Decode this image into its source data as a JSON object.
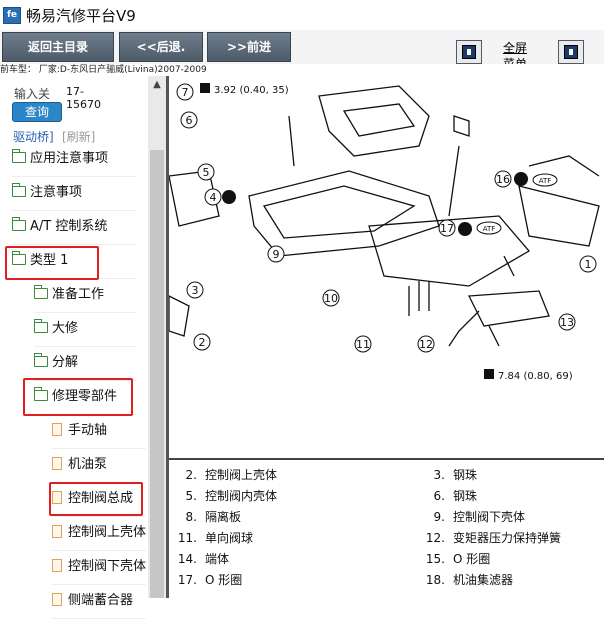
{
  "window": {
    "title": "畅易汽修平台V9",
    "icon": "app-logo-icon"
  },
  "toolbar": {
    "home_label": "返回主目录",
    "back_label": "<<后退.",
    "forward_label": ">>前进",
    "fullscreen_label": "全屏",
    "menu_label": "菜单"
  },
  "breadcrumb": "前车型： 厂家:D-东风日产骊威(Livina)2007-2009",
  "search": {
    "label": "输入关",
    "value_line1": "17-",
    "value_line2": "15670",
    "button_label": "查询"
  },
  "sidebar": {
    "section_title": "驱动桥]",
    "refresh_label": "[刷新]",
    "items": [
      {
        "label": "应用注意事项",
        "icon": "folder-icon"
      },
      {
        "label": "注意事项",
        "icon": "folder-icon"
      },
      {
        "label": "A/T 控制系统",
        "icon": "folder-icon"
      },
      {
        "label": "类型 1",
        "icon": "folder-open-icon",
        "highlighted": true
      },
      {
        "label": "准备工作",
        "icon": "folder-icon"
      },
      {
        "label": "大修",
        "icon": "folder-icon"
      },
      {
        "label": "分解",
        "icon": "folder-icon"
      },
      {
        "label": "修理零部件",
        "icon": "folder-open-icon",
        "highlighted": true
      },
      {
        "label": "手动轴",
        "icon": "doc-icon"
      },
      {
        "label": "机油泵",
        "icon": "doc-icon"
      },
      {
        "label": "控制阀总成",
        "icon": "doc-icon",
        "highlighted": true
      },
      {
        "label": "控制阀上壳体",
        "icon": "doc-icon"
      },
      {
        "label": "控制阀下壳体",
        "icon": "doc-icon"
      },
      {
        "label": "侧端蓄合器",
        "icon": "doc-icon"
      }
    ]
  },
  "diagram": {
    "torque_top": "3.92 (0.40, 35)",
    "torque_bottom": "7.84 (0.80, 69)",
    "atf_label": "ATF",
    "callouts": [
      "7",
      "6",
      "5",
      "4",
      "9",
      "3",
      "2",
      "16",
      "17",
      "10",
      "11",
      "12",
      "13",
      "1"
    ]
  },
  "legend": [
    {
      "num": "2.",
      "text": "控制阀上壳体"
    },
    {
      "num": "3.",
      "text": "钢珠"
    },
    {
      "num": "5.",
      "text": "控制阀内壳体"
    },
    {
      "num": "6.",
      "text": "钢珠"
    },
    {
      "num": "8.",
      "text": "隔离板"
    },
    {
      "num": "9.",
      "text": "控制阀下壳体"
    },
    {
      "num": "11.",
      "text": "单向阀球"
    },
    {
      "num": "12.",
      "text": "变矩器压力保持弹簧"
    },
    {
      "num": "14.",
      "text": "端体"
    },
    {
      "num": "15.",
      "text": "O 形圈"
    },
    {
      "num": "17.",
      "text": "O 形圈"
    },
    {
      "num": "18.",
      "text": "机油集滤器"
    }
  ]
}
